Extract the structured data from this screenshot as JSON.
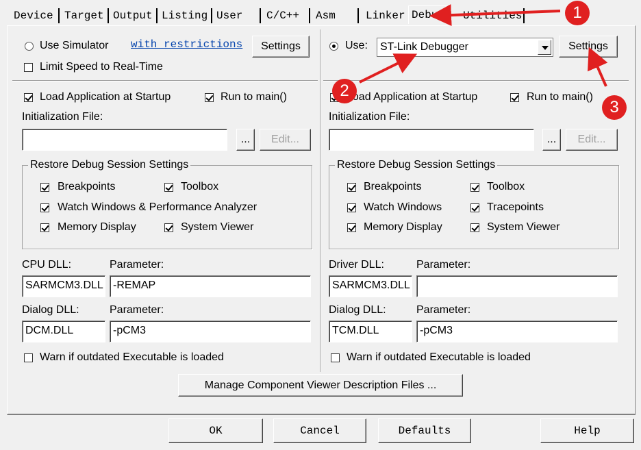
{
  "tabs": [
    {
      "label": "Device"
    },
    {
      "label": "Target"
    },
    {
      "label": "Output"
    },
    {
      "label": "Listing"
    },
    {
      "label": "User"
    },
    {
      "label": "C/C++"
    },
    {
      "label": "Asm"
    },
    {
      "label": "Linker"
    },
    {
      "label": "Debug",
      "active": true
    },
    {
      "label": "Utilities"
    }
  ],
  "left": {
    "use_simulator": "Use Simulator",
    "with_restrictions": "with restrictions",
    "settings": "Settings",
    "limit_speed": "Limit Speed to Real-Time",
    "load_app": "Load Application at Startup",
    "run_to_main": "Run to main()",
    "init_file_label": "Initialization File:",
    "init_file_value": "",
    "browse": "...",
    "edit": "Edit...",
    "restore_group": "Restore Debug Session Settings",
    "breakpoints": "Breakpoints",
    "toolbox": "Toolbox",
    "watch_windows": "Watch Windows & Performance Analyzer",
    "memory_display": "Memory Display",
    "system_viewer": "System Viewer",
    "dll_label": "CPU DLL:",
    "param_label": "Parameter:",
    "dll_value": "SARMCM3.DLL",
    "param_value": "-REMAP",
    "dialog_dll_label": "Dialog DLL:",
    "dialog_param_label": "Parameter:",
    "dialog_dll_value": "DCM.DLL",
    "dialog_param_value": "-pCM3",
    "warn_outdated": "Warn if outdated Executable is loaded"
  },
  "right": {
    "use": "Use:",
    "debugger": "ST-Link Debugger",
    "settings": "Settings",
    "load_app": "Load Application at Startup",
    "run_to_main": "Run to main()",
    "init_file_label": "Initialization File:",
    "init_file_value": "",
    "browse": "...",
    "edit": "Edit...",
    "restore_group": "Restore Debug Session Settings",
    "breakpoints": "Breakpoints",
    "toolbox": "Toolbox",
    "watch_windows": "Watch Windows",
    "tracepoints": "Tracepoints",
    "memory_display": "Memory Display",
    "system_viewer": "System Viewer",
    "dll_label": "Driver DLL:",
    "param_label": "Parameter:",
    "dll_value": "SARMCM3.DLL",
    "param_value": "",
    "dialog_dll_label": "Dialog DLL:",
    "dialog_param_label": "Parameter:",
    "dialog_dll_value": "TCM.DLL",
    "dialog_param_value": "-pCM3",
    "warn_outdated": "Warn if outdated Executable is loaded"
  },
  "manage_button": "Manage Component Viewer Description Files ...",
  "footer": {
    "ok": "OK",
    "cancel": "Cancel",
    "defaults": "Defaults",
    "help": "Help"
  },
  "annotations": {
    "one": "1",
    "two": "2",
    "three": "3",
    "color": "#e02020"
  }
}
